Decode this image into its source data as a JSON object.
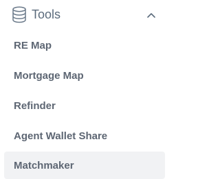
{
  "section": {
    "title": "Tools",
    "icon": "database-icon",
    "expanded": true,
    "chevron_icon": "chevron-up-icon"
  },
  "items": [
    {
      "label": "RE Map",
      "active": false
    },
    {
      "label": "Mortgage Map",
      "active": false
    },
    {
      "label": "Refinder",
      "active": false
    },
    {
      "label": "Agent Wallet Share",
      "active": false
    },
    {
      "label": "Matchmaker",
      "active": true
    }
  ],
  "colors": {
    "header_text": "#5b6b7c",
    "item_text": "#5d6673",
    "active_background": "#f1f2f4"
  }
}
